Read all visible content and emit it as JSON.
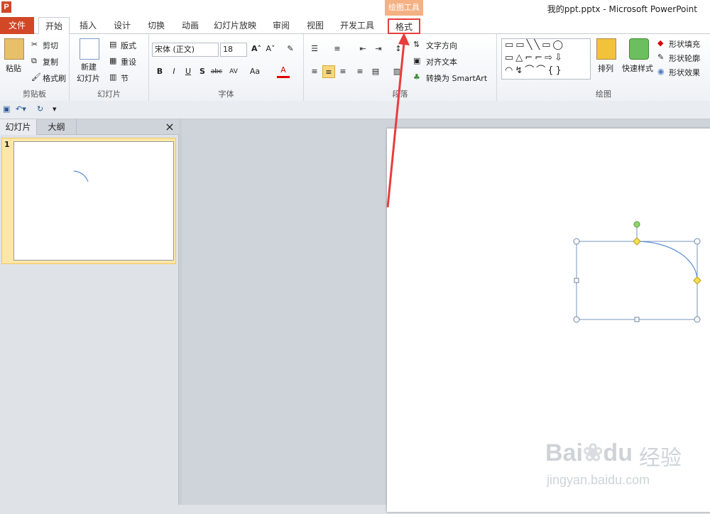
{
  "window": {
    "title": "我的ppt.pptx - Microsoft PowerPoint",
    "app_icon": "P"
  },
  "context_tab": {
    "label": "绘图工具"
  },
  "tabs": [
    "文件",
    "开始",
    "插入",
    "设计",
    "切换",
    "动画",
    "幻灯片放映",
    "审阅",
    "视图",
    "开发工具",
    "格式"
  ],
  "ribbon": {
    "clipboard": {
      "paste": "粘贴",
      "cut": "剪切",
      "copy": "复制",
      "format_painter": "格式刷",
      "group": "剪贴板"
    },
    "slides": {
      "new_slide_1": "新建",
      "new_slide_2": "幻灯片",
      "layout": "版式",
      "reset": "重设",
      "section": "节",
      "group": "幻灯片"
    },
    "font": {
      "font_name": "宋体 (正文)",
      "font_size": "18",
      "group": "字体"
    },
    "paragraph": {
      "text_direction": "文字方向",
      "align_text": "对齐文本",
      "smartart": "转换为 SmartArt",
      "group": "段落"
    },
    "drawing": {
      "arrange": "排列",
      "quick_styles": "快速样式",
      "shape_fill": "形状填充",
      "shape_outline": "形状轮廓",
      "shape_effects": "形状效果",
      "group": "绘图"
    }
  },
  "panel": {
    "tab_slides": "幻灯片",
    "tab_outline": "大纲",
    "slide_number": "1",
    "close": "×"
  },
  "watermark": {
    "brand": "Bai",
    "brand2": "du",
    "word": "经验",
    "url": "jingyan.baidu.com"
  },
  "colors": {
    "file_tab": "#d24726",
    "context": "#f4b183",
    "highlight": "#e83d3d",
    "arc": "#5b8fd6"
  }
}
